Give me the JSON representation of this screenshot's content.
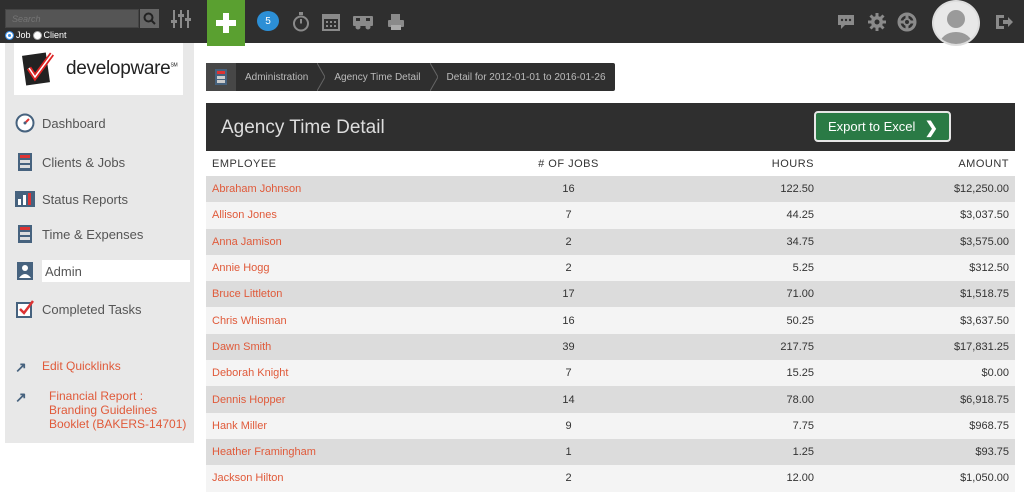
{
  "topbar": {
    "search_placeholder": "Search",
    "radio_job": "Job",
    "radio_client": "Client",
    "message_count": "5",
    "icons": [
      "plus-icon",
      "chat-bubble-icon",
      "stopwatch-icon",
      "calendar-icon",
      "truck-icon",
      "printer-icon",
      "comments-icon",
      "gear-icon",
      "lifebuoy-icon",
      "avatar",
      "logout-icon"
    ]
  },
  "logo": {
    "text": "developware",
    "mark": "SM"
  },
  "sidebar": {
    "items": [
      {
        "label": "Dashboard",
        "icon": "dashboard-gauge-icon"
      },
      {
        "label": "Clients & Jobs",
        "icon": "cabinet-icon"
      },
      {
        "label": "Status Reports",
        "icon": "bar-chart-icon"
      },
      {
        "label": "Time & Expenses",
        "icon": "cabinet-icon"
      },
      {
        "label": "Admin",
        "icon": "admin-user-icon"
      },
      {
        "label": "Completed Tasks",
        "icon": "checkbox-icon"
      }
    ],
    "edit_quicklinks": "Edit Quicklinks",
    "quicklink": "Financial Report : Branding Guidelines Booklet (BAKERS-14701)"
  },
  "breadcrumb": {
    "items": [
      "Administration",
      "Agency Time Detail",
      "Detail for 2012-01-01 to 2016-01-26"
    ]
  },
  "panel": {
    "title": "Agency Time Detail",
    "export_label": "Export to Excel"
  },
  "table": {
    "headers": [
      "EMPLOYEE",
      "# OF JOBS",
      "HOURS",
      "AMOUNT"
    ],
    "rows": [
      [
        "Abraham Johnson",
        "16",
        "122.50",
        "$12,250.00"
      ],
      [
        "Allison Jones",
        "7",
        "44.25",
        "$3,037.50"
      ],
      [
        "Anna Jamison",
        "2",
        "34.75",
        "$3,575.00"
      ],
      [
        "Annie Hogg",
        "2",
        "5.25",
        "$312.50"
      ],
      [
        "Bruce Littleton",
        "17",
        "71.00",
        "$1,518.75"
      ],
      [
        "Chris Whisman",
        "16",
        "50.25",
        "$3,637.50"
      ],
      [
        "Dawn Smith",
        "39",
        "217.75",
        "$17,831.25"
      ],
      [
        "Deborah Knight",
        "7",
        "15.25",
        "$0.00"
      ],
      [
        "Dennis Hopper",
        "14",
        "78.00",
        "$6,918.75"
      ],
      [
        "Hank Miller",
        "9",
        "7.75",
        "$968.75"
      ],
      [
        "Heather Framingham",
        "1",
        "1.25",
        "$93.75"
      ],
      [
        "Jackson Hilton",
        "2",
        "12.00",
        "$1,050.00"
      ]
    ]
  },
  "colors": {
    "topbar": "#2f2f2f",
    "add_button": "#5aa030",
    "export_button": "#2a7a45",
    "link": "#e05a3a",
    "row_shade": "#dcdcdc"
  }
}
